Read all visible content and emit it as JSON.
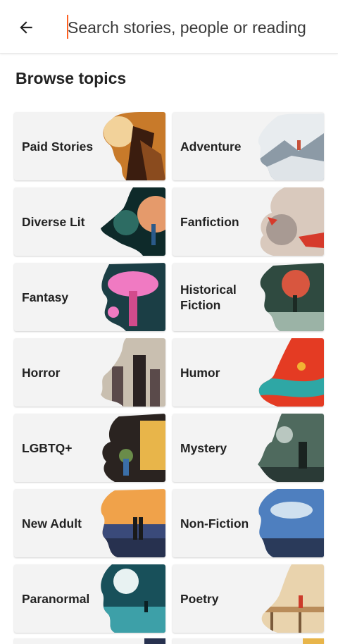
{
  "search": {
    "placeholder": "Search stories, people or reading lists"
  },
  "section_title": "Browse topics",
  "topics": [
    {
      "label": "Paid Stories",
      "art": "paid-stories-art",
      "colors": [
        "#3b1d0f",
        "#c87a2a",
        "#f2d29a"
      ]
    },
    {
      "label": "Adventure",
      "art": "adventure-art",
      "colors": [
        "#e8ecef",
        "#8c9aa6",
        "#c7513a"
      ]
    },
    {
      "label": "Diverse Lit",
      "art": "diverse-lit-art",
      "colors": [
        "#0e2a2a",
        "#2d6c63",
        "#e59a6b"
      ]
    },
    {
      "label": "Fanfiction",
      "art": "fanfiction-art",
      "colors": [
        "#d9c9bd",
        "#a89a93",
        "#d63a2b"
      ]
    },
    {
      "label": "Fantasy",
      "art": "fantasy-art",
      "colors": [
        "#1b3e45",
        "#d24b8c",
        "#f07ac2"
      ]
    },
    {
      "label": "Historical\nFiction",
      "art": "historical-fiction-art",
      "colors": [
        "#2f4a40",
        "#d8563f",
        "#9bb3a6"
      ]
    },
    {
      "label": "Horror",
      "art": "horror-art",
      "colors": [
        "#c9bfb0",
        "#5a4a4a",
        "#2a2222"
      ]
    },
    {
      "label": "Humor",
      "art": "humor-art",
      "colors": [
        "#e43b23",
        "#2ea7a5",
        "#f2b233"
      ]
    },
    {
      "label": "LGBTQ+",
      "art": "lgbtq-art",
      "colors": [
        "#2a2320",
        "#e8b54a",
        "#6a8c4a"
      ]
    },
    {
      "label": "Mystery",
      "art": "mystery-art",
      "colors": [
        "#4f6a5e",
        "#2a3a36",
        "#b9c7c0"
      ]
    },
    {
      "label": "New Adult",
      "art": "new-adult-art",
      "colors": [
        "#f0a24a",
        "#3a4a7a",
        "#27314f"
      ]
    },
    {
      "label": "Non-Fiction",
      "art": "non-fiction-art",
      "colors": [
        "#4e7fbf",
        "#cfe0ef",
        "#2a3a5a"
      ]
    },
    {
      "label": "Paranormal",
      "art": "paranormal-art",
      "colors": [
        "#18505a",
        "#3da0a8",
        "#e8f2f2"
      ]
    },
    {
      "label": "Poetry",
      "art": "poetry-art",
      "colors": [
        "#e9d3ad",
        "#b98c5a",
        "#cc3b2a"
      ]
    }
  ],
  "accent_color": "#ff6122",
  "icons": {
    "back": "back-arrow-icon"
  }
}
